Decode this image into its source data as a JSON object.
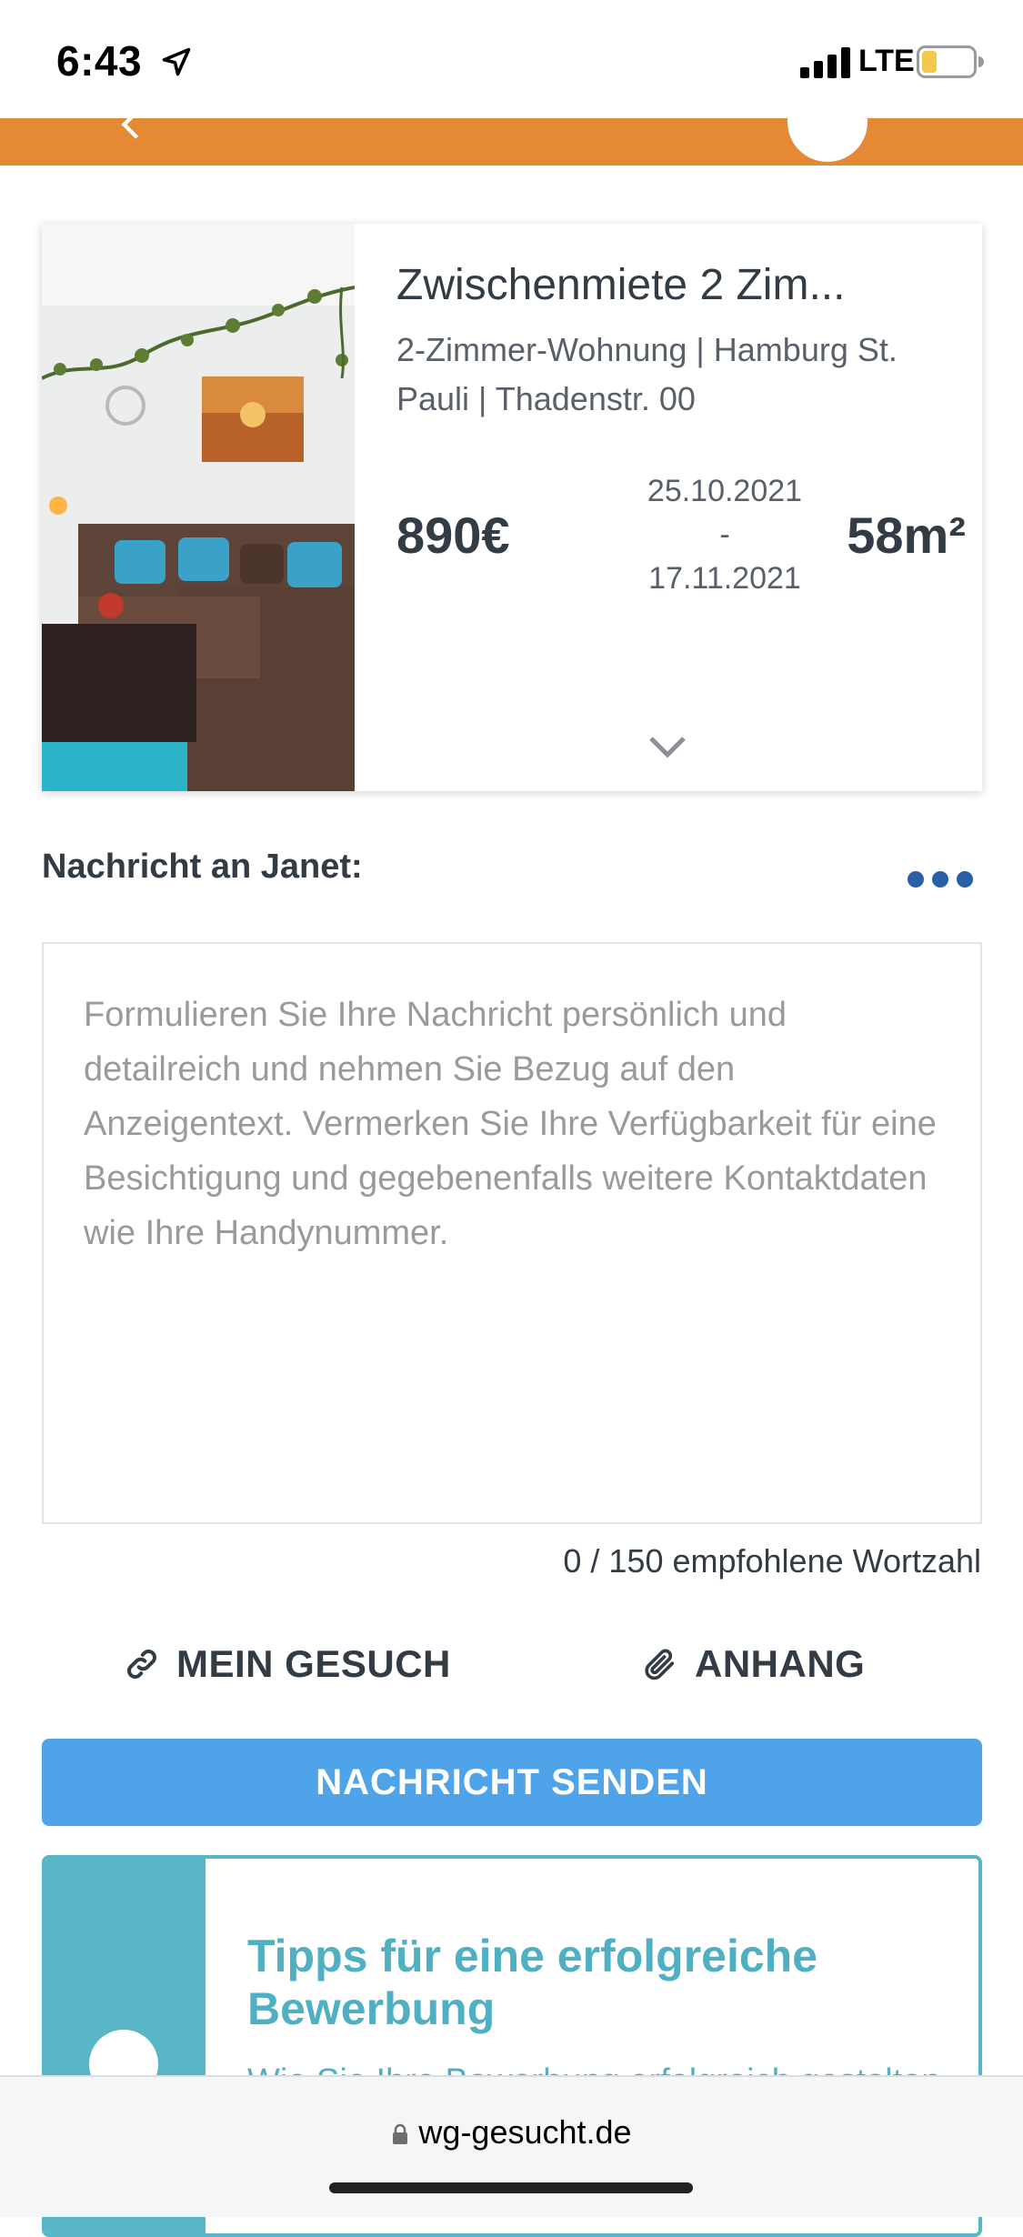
{
  "status_bar": {
    "time": "6:43",
    "network": "LTE",
    "icons": [
      "location-arrow-icon",
      "signal-bars-icon",
      "battery-icon"
    ]
  },
  "header": {
    "accent_color": "#e48a35"
  },
  "listing": {
    "title": "Zwischenmiete 2 Zim...",
    "subtitle": "2-Zimmer-Wohnung | Hamburg St. Pauli | Thadenstr. 00",
    "price": "890€",
    "date_from": "25.10.2021",
    "date_separator": "-",
    "date_to": "17.11.2021",
    "size": "58m²"
  },
  "message": {
    "label": "Nachricht an Janet:",
    "value": "",
    "placeholder": "Formulieren Sie Ihre Nachricht persönlich und detailreich und nehmen Sie Bezug auf den Anzeigentext. Vermerken Sie Ihre Verfügbarkeit für eine Besichtigung und gegebenenfalls weitere Kontaktdaten wie Ihre Handynummer.",
    "word_count": "0 / 150 empfohlene Wortzahl"
  },
  "actions": {
    "gesuch_label": "MEIN GESUCH",
    "anhang_label": "ANHANG",
    "send_label": "NACHRICHT SENDEN",
    "send_color": "#4fa4e9"
  },
  "tips": {
    "title": "Tipps für eine erfolgreiche Bewerbung",
    "body": "Wie Sie Ihre Bewerbung erfolgreich gestalten",
    "accent_color": "#58b6c7"
  },
  "browser": {
    "url": "wg-gesucht.de"
  }
}
